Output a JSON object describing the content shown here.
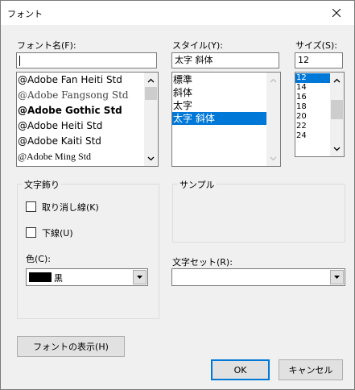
{
  "window": {
    "title": "フォント"
  },
  "font_name": {
    "label": "フォント名(F):",
    "value": "",
    "items": [
      {
        "text": "@Adobe Fan Heiti Std",
        "style": "sans"
      },
      {
        "text": "@Adobe Fangsong Std",
        "style": "fangsong"
      },
      {
        "text": "@Adobe Gothic Std",
        "style": "bold"
      },
      {
        "text": "@Adobe Heiti Std",
        "style": "sans"
      },
      {
        "text": "@Adobe Kaiti Std",
        "style": "kaiti"
      },
      {
        "text": "@Adobe Ming Std",
        "style": "serif"
      }
    ]
  },
  "style": {
    "label": "スタイル(Y):",
    "value": "太字 斜体",
    "items": [
      "標準",
      "斜体",
      "太字",
      "太字 斜体"
    ],
    "selected_index": 3
  },
  "size": {
    "label": "サイズ(S):",
    "value": "12",
    "items": [
      "12",
      "14",
      "16",
      "18",
      "20",
      "22",
      "24"
    ],
    "selected_index": 0
  },
  "effects": {
    "title": "文字飾り",
    "strikeout_label": "取り消し線(K)",
    "underline_label": "下線(U)",
    "strikeout_checked": false,
    "underline_checked": false
  },
  "color": {
    "label": "色(C):",
    "value": "黒",
    "swatch": "#000000"
  },
  "sample": {
    "title": "サンプル"
  },
  "script": {
    "label": "文字セット(R):",
    "value": ""
  },
  "buttons": {
    "show_fonts": "フォントの表示(H)",
    "ok": "OK",
    "cancel": "キャンセル"
  },
  "colors": {
    "selection": "#0078d7",
    "background": "#f0f0f0"
  }
}
